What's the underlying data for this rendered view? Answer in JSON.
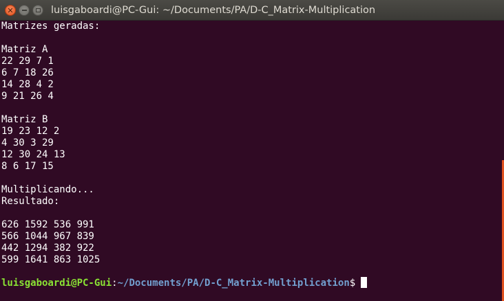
{
  "window": {
    "title": "luisgaboardi@PC-Gui: ~/Documents/PA/D-C_Matrix-Multiplication",
    "close_glyph": "✕"
  },
  "terminal": {
    "lines": [
      "Matrizes geradas:",
      "",
      "Matriz A",
      "22 29 7 1",
      "6 7 18 26",
      "14 28 4 2",
      "9 21 26 4",
      "",
      "Matriz B",
      "19 23 12 2",
      "4 30 3 29",
      "12 30 24 13",
      "8 6 17 15",
      "",
      "Multiplicando...",
      "Resultado:",
      "",
      "626 1592 536 991",
      "566 1044 967 839",
      "442 1294 382 922",
      "599 1641 863 1025"
    ],
    "prompt": {
      "user_host": "luisgaboardi@PC-Gui",
      "colon": ":",
      "path": "~/Documents/PA/D-C_Matrix-Multiplication",
      "dollar": "$"
    }
  },
  "colors": {
    "background": "#300a24",
    "prompt_user": "#8ae234",
    "prompt_path": "#729fcf",
    "scrollbar": "#e0521f"
  }
}
